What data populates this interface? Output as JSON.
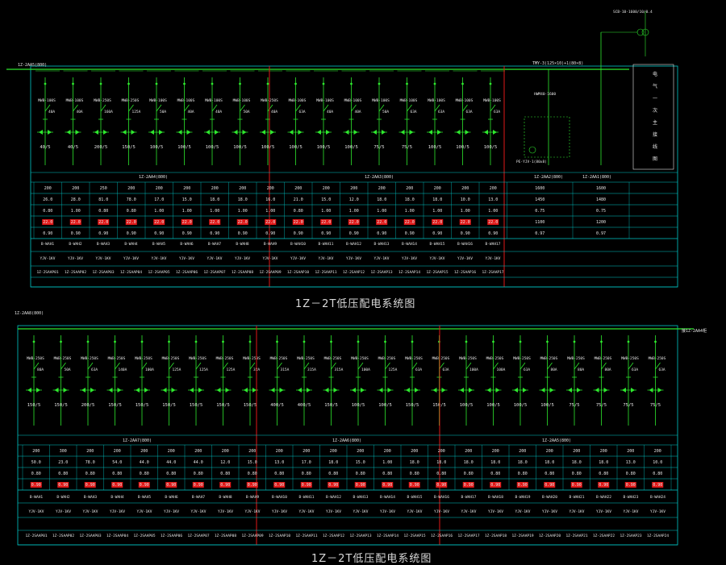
{
  "colors": {
    "background": "#000000",
    "frame_cyan": "#00c8c8",
    "busbar_green": "#2ee82e",
    "circuit_green": "#2ee82e",
    "separator_red": "#e01818",
    "text_white": "#e6e6e6",
    "highlight_red": "#e01818",
    "title_gray": "#d8d8d8"
  },
  "diagram_top": {
    "title": "1Z－2T低压配电系统图",
    "incoming_label": "1Z-2AA5(800)",
    "busbar_label": "TMY-3(125×10)+1(80×8)",
    "breaker_note": "MWB-100S",
    "circuits": [
      {
        "breaker": "MWB-100S",
        "rating": "40A",
        "ct": "40/5",
        "cable": "1Z-2SAAP01"
      },
      {
        "breaker": "MWB-100S",
        "rating": "40A",
        "ct": "40/5",
        "cable": "1Z-2SAAP02"
      },
      {
        "breaker": "MWB-250S",
        "rating": "160A",
        "ct": "200/5",
        "cable": "1Z-2SAAP03"
      },
      {
        "breaker": "MWB-250S",
        "rating": "125A",
        "ct": "150/5",
        "cable": "1Z-2SAAP04"
      },
      {
        "breaker": "MWB-100S",
        "rating": "50A",
        "ct": "100/5",
        "cable": "1Z-2SAAP05"
      },
      {
        "breaker": "MWB-100S",
        "rating": "40A",
        "ct": "100/5",
        "cable": "1Z-2SAAP06"
      },
      {
        "breaker": "MWB-100S",
        "rating": "40A",
        "ct": "100/5",
        "cable": "1Z-2SAAP07"
      },
      {
        "breaker": "MWB-100S",
        "rating": "50A",
        "ct": "100/5",
        "cable": "1Z-2SAAP08"
      },
      {
        "breaker": "MWB-250S",
        "rating": "40A",
        "ct": "100/5",
        "cable": "1Z-2SAAP09"
      },
      {
        "breaker": "MWB-100S",
        "rating": "63A",
        "ct": "100/5",
        "cable": "1Z-2SAAP10"
      },
      {
        "breaker": "MWB-100S",
        "rating": "40A",
        "ct": "100/5",
        "cable": "1Z-2SAAP11"
      },
      {
        "breaker": "MWB-100S",
        "rating": "40A",
        "ct": "100/5",
        "cable": "1Z-2SAAP12"
      },
      {
        "breaker": "MWB-100S",
        "rating": "50A",
        "ct": "75/5",
        "cable": "1Z-2SAAP13"
      },
      {
        "breaker": "MWB-100S",
        "rating": "63A",
        "ct": "75/5",
        "cable": "1Z-2SAAP14"
      },
      {
        "breaker": "MWB-100S",
        "rating": "63A",
        "ct": "100/5",
        "cable": "1Z-2SAAP15"
      },
      {
        "breaker": "MWB-100S",
        "rating": "63A",
        "ct": "100/5",
        "cable": "1Z-2SAAP16"
      },
      {
        "breaker": "MWB-100S",
        "rating": "63A",
        "ct": "100/5",
        "cable": "1Z-2SAAP17"
      }
    ],
    "section_labels": [
      "1Z-2AA4(800)",
      "1Z-2AA3(800)",
      "1Z-2AA2(800)",
      "1Z-2AA1(800)"
    ],
    "table_rows": [
      [
        "200",
        "200",
        "250",
        "200",
        "200",
        "200",
        "200",
        "200",
        "200",
        "200",
        "200",
        "200",
        "200",
        "200",
        "200",
        "200",
        "200",
        "1600",
        "1600"
      ],
      [
        "26.0",
        "28.0",
        "81.0",
        "78.0",
        "17.0",
        "15.0",
        "18.0",
        "18.0",
        "16.0",
        "21.0",
        "15.0",
        "12.0",
        "18.0",
        "18.0",
        "18.0",
        "10.0",
        "13.0",
        "1450",
        "1480"
      ],
      [
        "0.80",
        "1.00",
        "0.80",
        "0.80",
        "1.00",
        "1.00",
        "1.00",
        "1.00",
        "1.00",
        "0.80",
        "1.00",
        "1.00",
        "1.00",
        "1.00",
        "1.00",
        "1.00",
        "1.00",
        "0.75",
        "0.75"
      ],
      [
        "22.0",
        "22.0",
        "22.0",
        "22.0",
        "22.0",
        "22.0",
        "22.0",
        "22.0",
        "22.0",
        "22.0",
        "22.0",
        "22.0",
        "22.0",
        "22.0",
        "22.0",
        "22.0",
        "22.0",
        "1100",
        "1200"
      ],
      [
        "0.90",
        "0.90",
        "0.90",
        "0.90",
        "0.90",
        "0.90",
        "0.90",
        "0.90",
        "0.90",
        "0.90",
        "0.90",
        "0.90",
        "0.90",
        "0.90",
        "0.90",
        "0.90",
        "0.90",
        "0.97",
        "0.97"
      ]
    ],
    "right_panel": [
      "电",
      "气",
      "一",
      "次",
      "主",
      "接",
      "线",
      "图"
    ],
    "transformer_note": "SCB-10-1600/10/0.4",
    "meter_label": "PE-YJV-1(80x8)"
  },
  "diagram_bottom": {
    "title": "1Z－2T低压配电系统图",
    "incoming_label": "1Z-2AA8(800)",
    "right_label": "接1Z-2AA4柜",
    "circuits_ct": [
      "150/5",
      "150/5",
      "200/5",
      "150/5",
      "150/5",
      "150/5",
      "150/5",
      "150/5",
      "150/5",
      "400/5",
      "400/5",
      "150/5",
      "100/5",
      "100/5",
      "150/5",
      "150/5",
      "100/5",
      "100/5",
      "100/5",
      "100/5",
      "75/5",
      "75/5",
      "75/5",
      "75/5"
    ],
    "circuits_rating": [
      "80A",
      "50A",
      "63A",
      "140A",
      "100A",
      "125A",
      "125A",
      "125A",
      "32A",
      "315A",
      "315A",
      "315A",
      "100A",
      "125A",
      "63A",
      "63A",
      "100A",
      "100A",
      "63A",
      "80A",
      "80A",
      "80A",
      "63A",
      "63A"
    ],
    "section_labels": [
      "1Z-2AA7(800)",
      "1Z-2AA6(800)",
      "1Z-2AA5(800)"
    ],
    "table_rows": [
      [
        "200",
        "300",
        "200",
        "200",
        "200",
        "200",
        "200",
        "200",
        "200",
        "200",
        "200",
        "200",
        "200",
        "200",
        "200",
        "200",
        "200",
        "200",
        "200",
        "200",
        "200",
        "200",
        "200",
        "200"
      ],
      [
        "50.0",
        "23.0",
        "78.0",
        "54.0",
        "44.0",
        "44.0",
        "44.0",
        "12.0",
        "15.0",
        "13.0",
        "17.0",
        "18.0",
        "15.0",
        "1.00",
        "18.0",
        "18.0",
        "18.0",
        "18.0",
        "18.0",
        "18.0",
        "18.0",
        "18.0",
        "13.0",
        "10.0"
      ],
      [
        "0.80",
        "0.80",
        "0.80",
        "0.80",
        "0.80",
        "0.80",
        "0.80",
        "0.80",
        "0.80",
        "0.80",
        "0.80",
        "0.80",
        "0.80",
        "0.80",
        "0.80",
        "0.80",
        "0.80",
        "0.80",
        "0.80",
        "0.80",
        "0.80",
        "0.80",
        "0.80",
        "0.80"
      ],
      [
        "0.90",
        "0.90",
        "0.90",
        "0.90",
        "0.90",
        "0.90",
        "0.90",
        "0.90",
        "0.90",
        "0.90",
        "0.90",
        "0.90",
        "0.90",
        "0.90",
        "0.90",
        "0.90",
        "0.90",
        "0.90",
        "0.90",
        "0.90",
        "0.90",
        "0.90",
        "0.90",
        "0.90"
      ]
    ]
  }
}
